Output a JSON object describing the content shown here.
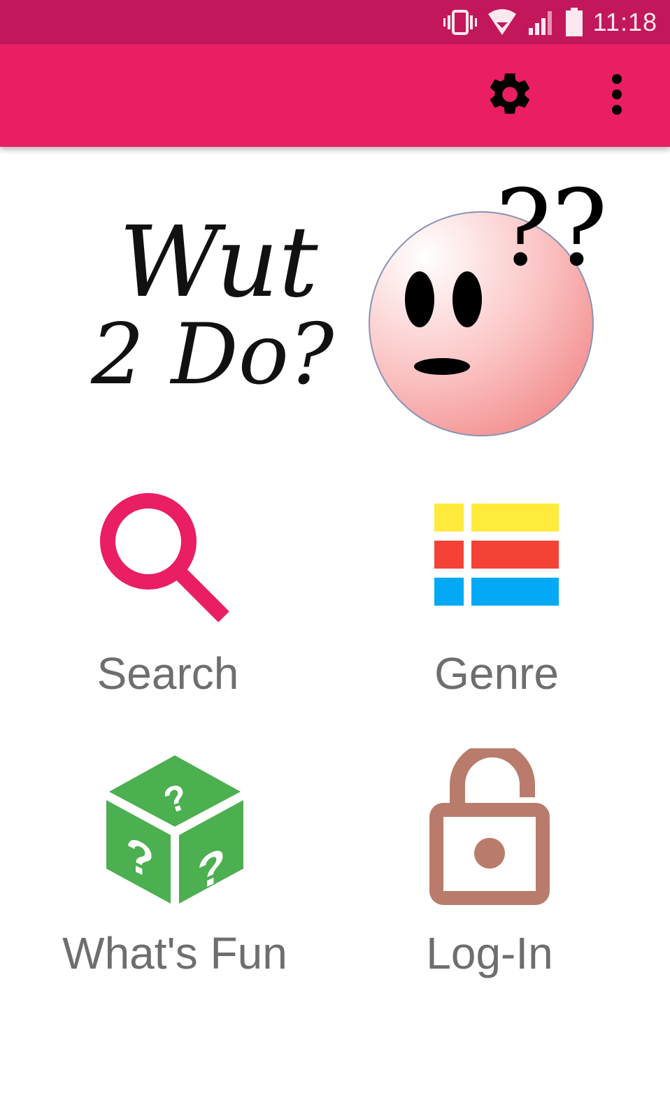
{
  "status_bar": {
    "time": "11:18",
    "icons": [
      "vibrate-icon",
      "wifi-icon",
      "signal-icon",
      "battery-icon"
    ]
  },
  "app_bar": {
    "actions": [
      "gear-icon",
      "more-vert-icon"
    ],
    "color": "#e91e63",
    "status_color": "#c2185b"
  },
  "logo": {
    "line1": "Wut",
    "line2": "2 Do?",
    "mark": "??"
  },
  "menu": {
    "items": [
      {
        "label": "Search",
        "icon": "search-icon",
        "color": "#e91e63"
      },
      {
        "label": "Genre",
        "icon": "genre-grid-icon",
        "colors": [
          "#ffeb3b",
          "#f44336",
          "#03a9f4"
        ]
      },
      {
        "label": "What's Fun",
        "icon": "question-dice-icon",
        "color": "#4caf50"
      },
      {
        "label": "Log-In",
        "icon": "unlocked-padlock-icon",
        "color": "#b97c6c"
      }
    ]
  }
}
